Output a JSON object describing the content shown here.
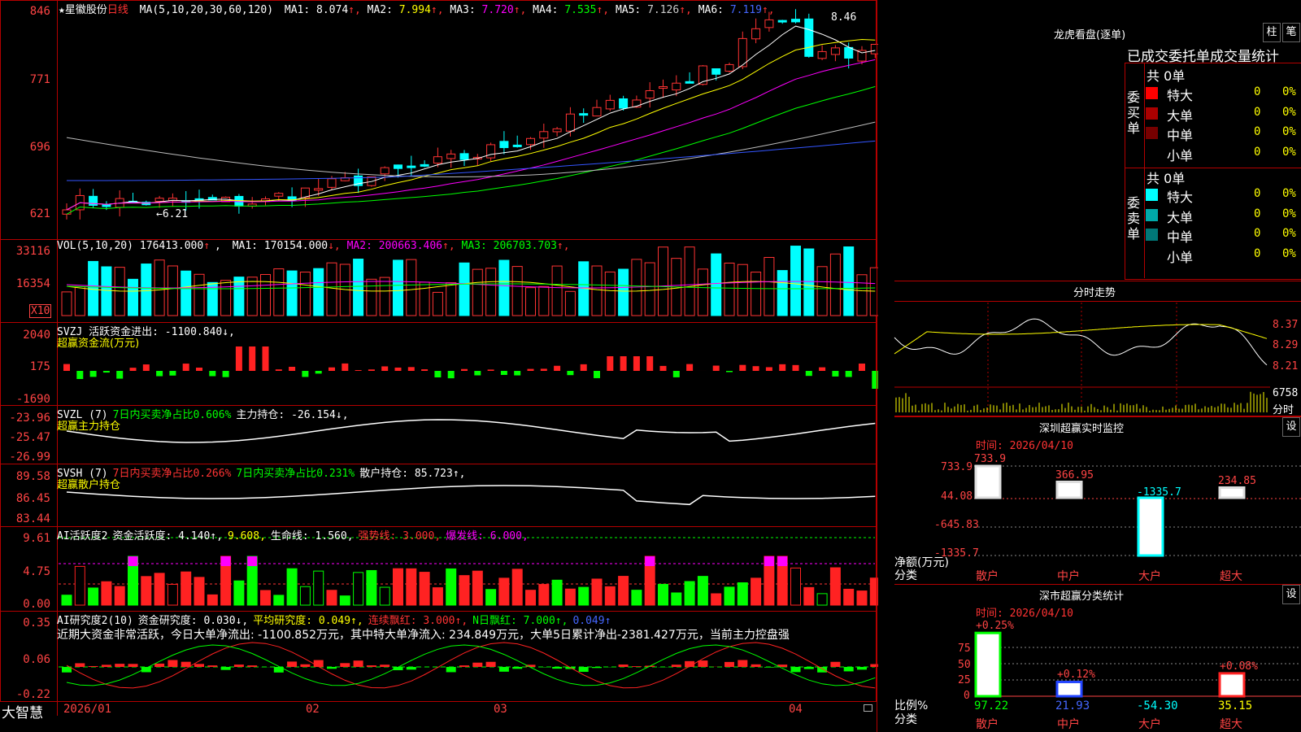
{
  "stock": {
    "name": "★星徽股份",
    "period": "日线",
    "ma_params": "MA(5,10,20,30,60,120)",
    "ma_values": [
      {
        "label": "MA1:",
        "value": "8.074",
        "arrow": "↑",
        "color": "#ffffff"
      },
      {
        "label": "MA2:",
        "value": "7.994",
        "arrow": "↑",
        "color": "#ffff00"
      },
      {
        "label": "MA3:",
        "value": "7.720",
        "arrow": "↑",
        "color": "#ff00ff"
      },
      {
        "label": "MA4:",
        "value": "7.535",
        "arrow": "↑",
        "color": "#00ff00"
      },
      {
        "label": "MA5:",
        "value": "7.126",
        "arrow": "↑",
        "color": "#cccccc"
      },
      {
        "label": "MA6:",
        "value": "7.119",
        "arrow": "↑",
        "color": "#4466ff"
      }
    ],
    "high_marker": "8.46",
    "low_marker": "←6.21",
    "price_axis": [
      "846",
      "771",
      "696",
      "621"
    ]
  },
  "volume": {
    "params": "VOL(5,10,20)",
    "value": "176413.000",
    "arrow": "↑",
    "ma": [
      {
        "label": "MA1:",
        "value": "170154.000",
        "arrow": "↓",
        "color": "#ffffff"
      },
      {
        "label": "MA2:",
        "value": "200663.406",
        "arrow": "↑",
        "color": "#ff00ff"
      },
      {
        "label": "MA3:",
        "value": "206703.703",
        "arrow": "↑",
        "color": "#00ff00"
      }
    ],
    "axis": [
      "33116",
      "16354"
    ],
    "unit_label": "X10"
  },
  "svzj": {
    "header": "SVZJ  活跃资金进出: -1100.840↓,",
    "subtitle": "超赢资金流(万元)",
    "axis": [
      "2040",
      "175",
      "-1690"
    ]
  },
  "svzl": {
    "header_prefix": "SVZL (7)",
    "header_green": "7日内买卖净占比0.606%",
    "header_white": "主力持仓: -26.154↓,",
    "subtitle": "超赢主力持仓",
    "axis": [
      "-23.96",
      "-25.47",
      "-26.99"
    ]
  },
  "svsh": {
    "header_prefix": "SVSH (7)",
    "header_red": "7日内买卖净占比0.266%",
    "header_green": "7日内买卖净占比0.231%",
    "header_white": "散户持仓: 85.723↑,",
    "subtitle": "超赢散户持仓",
    "axis": [
      "89.58",
      "86.45",
      "83.44"
    ]
  },
  "ai_active": {
    "title": "AI活跃度2",
    "a_label": "资金活跃度: 4.140↑,",
    "b_label": "9.608,",
    "c_label": "生命线: 1.560,",
    "d_label": "强势线: 3.000,",
    "e_label": "爆发线: 6.000,",
    "axis": [
      "9.61",
      "4.75",
      "0.00"
    ]
  },
  "ai_research": {
    "title": "AI研究度2(10)",
    "a_label": "资金研究度: 0.030↓,",
    "b_label": "平均研究度: 0.049↑,",
    "c_label": "连续飘红: 3.000↑,",
    "d_label": "N日飘红: 7.000↑,",
    "e_label": "0.049↑",
    "summary": "近期大资金非常活跃，今日大单净流出: -1100.852万元，其中特大单净流入: 234.849万元，大单5日累计净出-2381.427万元，当前主力控盘强",
    "axis": [
      "0.35",
      "0.06",
      "-0.22"
    ]
  },
  "time_axis": {
    "brand": "大智慧",
    "labels": [
      "2026/01",
      "02",
      "03",
      "04"
    ]
  },
  "longhu": {
    "title": "龙虎看盘(逐单)",
    "btn_a": "柱",
    "btn_b": "笔",
    "tabs": "已成交委托单成交量统计",
    "buy_total": "共 0单",
    "sell_total": "共 0单",
    "buy_side": "委买单",
    "sell_side": "委卖单",
    "buy_rows": [
      {
        "label": "特大",
        "count": "0",
        "pct": "0%",
        "color": "#ff0000"
      },
      {
        "label": "大单",
        "count": "0",
        "pct": "0%",
        "color": "#aa0000"
      },
      {
        "label": "中单",
        "count": "0",
        "pct": "0%",
        "color": "#770000"
      },
      {
        "label": "小单",
        "count": "0",
        "pct": "0%",
        "color": "#000000"
      }
    ],
    "sell_rows": [
      {
        "label": "特大",
        "count": "0",
        "pct": "0%",
        "color": "#00ffff"
      },
      {
        "label": "大单",
        "count": "0",
        "pct": "0%",
        "color": "#00aaaa"
      },
      {
        "label": "中单",
        "count": "0",
        "pct": "0%",
        "color": "#007777"
      },
      {
        "label": "小单",
        "count": "0",
        "pct": "0%",
        "color": "#000000"
      }
    ]
  },
  "intraday": {
    "title": "分时走势",
    "axis": [
      "8.37",
      "8.29",
      "8.21"
    ],
    "vol_label": "6758",
    "vol_unit": "分时"
  },
  "sz_monitor": {
    "title": "深圳超赢实时监控",
    "btn": "设",
    "time": "时间: 2026/04/10",
    "axis": [
      "733.9",
      "44.08",
      "-645.83",
      "-1335.7"
    ],
    "axis_title": "净额(万元)",
    "axis_sub": "分类",
    "bars": [
      {
        "label": "733.9",
        "value": 733.9,
        "category": "散户",
        "label_color": "#ff4444"
      },
      {
        "label": "366.95",
        "value": 366.95,
        "category": "中户",
        "label_color": "#ff4444"
      },
      {
        "label": "-1335.7",
        "value": -1335.7,
        "category": "大户",
        "label_color": "#00ffff"
      },
      {
        "label": "234.85",
        "value": 234.85,
        "category": "超大",
        "label_color": "#ff4444"
      }
    ]
  },
  "sz_class": {
    "title": "深市超赢分类统计",
    "btn": "设",
    "time": "时间: 2026/04/10",
    "axis": [
      "75",
      "50",
      "25",
      "0"
    ],
    "axis_title": "比例%",
    "axis_sub": "分类",
    "bars": [
      {
        "top_label": "+0.25%",
        "bottom": "97.22",
        "category": "散户",
        "value": 97.22,
        "bottom_color": "#00ff00",
        "cat_color": "#ff4444"
      },
      {
        "top_label": "+0.12%",
        "bottom": "21.93",
        "category": "中户",
        "value": 21.93,
        "bottom_color": "#4466ff",
        "cat_color": "#ff4444"
      },
      {
        "top_label": "",
        "bottom": "-54.30",
        "category": "大户",
        "value": 0,
        "bottom_color": "#00ffff",
        "cat_color": "#ff4444"
      },
      {
        "top_label": "+0.08%",
        "bottom": "35.15",
        "category": "超大",
        "value": 35.15,
        "bottom_color": "#ffff00",
        "cat_color": "#ff4444"
      }
    ]
  }
}
